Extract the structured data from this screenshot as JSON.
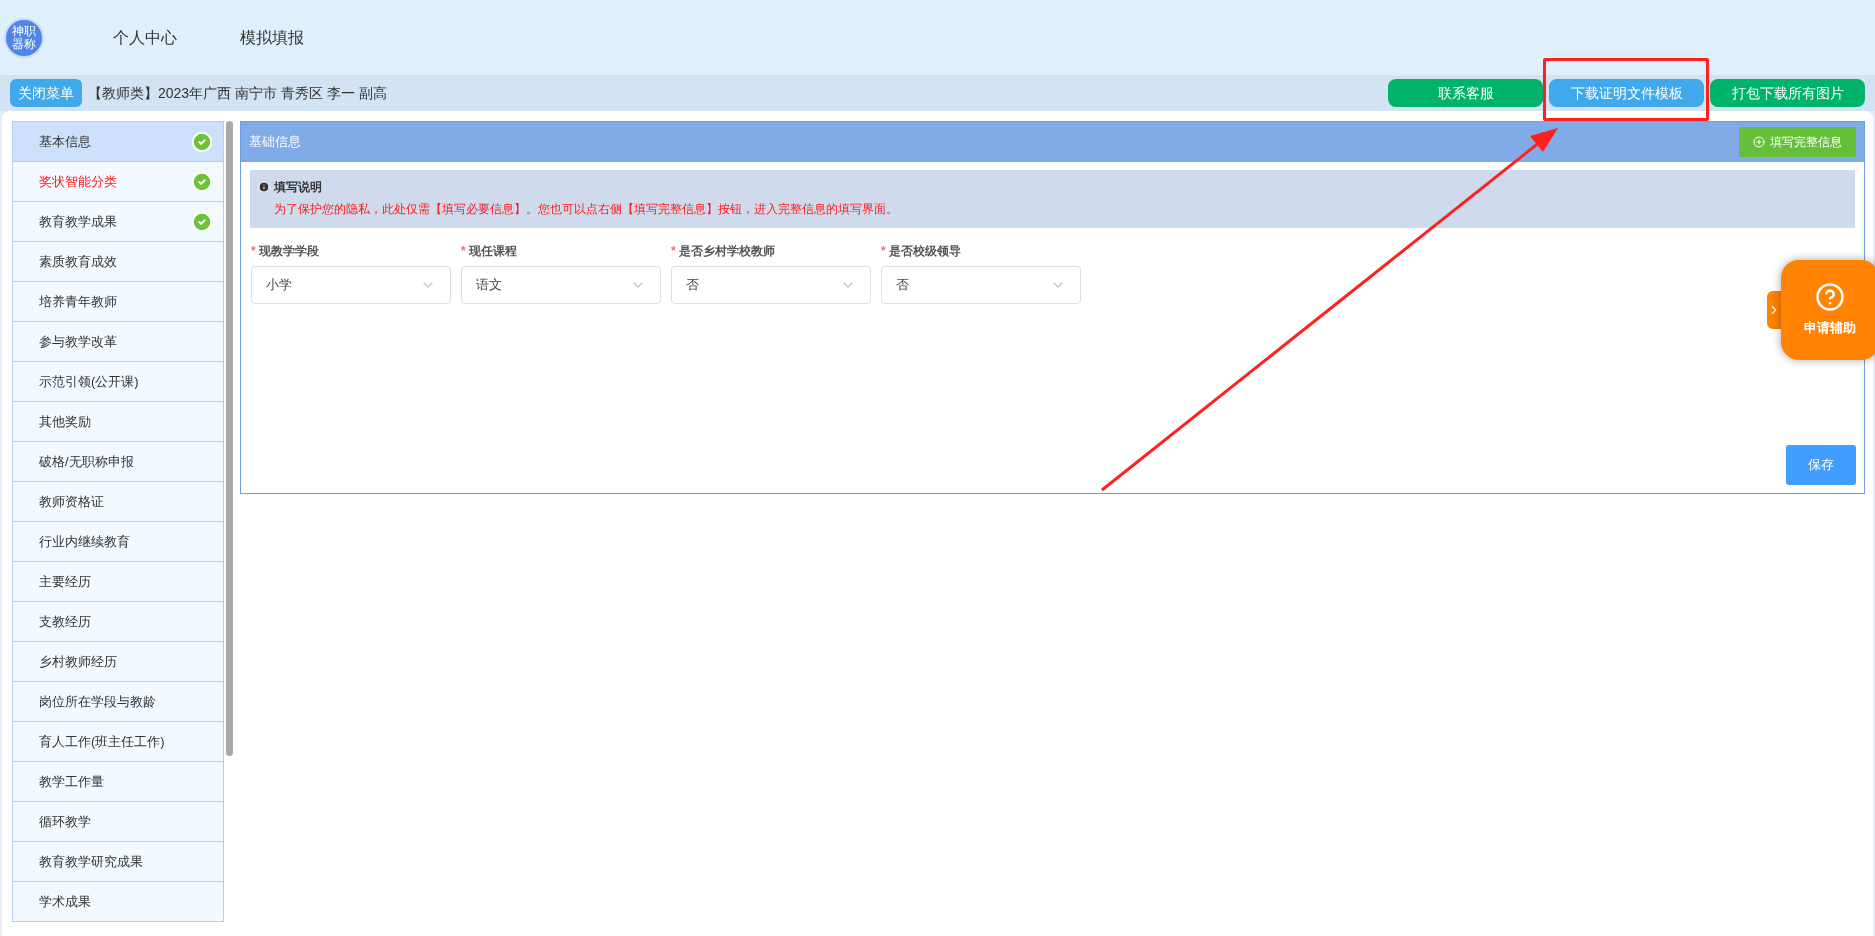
{
  "header": {
    "logo": "神职器称",
    "nav": [
      {
        "label": "个人中心"
      },
      {
        "label": "模拟填报"
      }
    ]
  },
  "toolbar": {
    "menu_button": "关闭菜单",
    "breadcrumb": "【教师类】2023年广西 南宁市 青秀区 李一 副高",
    "buttons": [
      {
        "label": "联系客服",
        "kind": "green"
      },
      {
        "label": "下载证明文件模板",
        "kind": "blue"
      },
      {
        "label": "打包下载所有图片",
        "kind": "green"
      }
    ]
  },
  "sidebar": {
    "items": [
      {
        "label": "基本信息",
        "selected": true,
        "done": true,
        "alert": false
      },
      {
        "label": "奖状智能分类",
        "selected": false,
        "done": true,
        "alert": true
      },
      {
        "label": "教育教学成果",
        "selected": false,
        "done": true,
        "alert": false
      },
      {
        "label": "素质教育成效",
        "selected": false,
        "done": false,
        "alert": false
      },
      {
        "label": "培养青年教师",
        "selected": false,
        "done": false,
        "alert": false
      },
      {
        "label": "参与教学改革",
        "selected": false,
        "done": false,
        "alert": false
      },
      {
        "label": "示范引领(公开课)",
        "selected": false,
        "done": false,
        "alert": false
      },
      {
        "label": "其他奖励",
        "selected": false,
        "done": false,
        "alert": false
      },
      {
        "label": "破格/无职称申报",
        "selected": false,
        "done": false,
        "alert": false
      },
      {
        "label": "教师资格证",
        "selected": false,
        "done": false,
        "alert": false
      },
      {
        "label": "行业内继续教育",
        "selected": false,
        "done": false,
        "alert": false
      },
      {
        "label": "主要经历",
        "selected": false,
        "done": false,
        "alert": false
      },
      {
        "label": "支教经历",
        "selected": false,
        "done": false,
        "alert": false
      },
      {
        "label": "乡村教师经历",
        "selected": false,
        "done": false,
        "alert": false
      },
      {
        "label": "岗位所在学段与教龄",
        "selected": false,
        "done": false,
        "alert": false
      },
      {
        "label": "育人工作(班主任工作)",
        "selected": false,
        "done": false,
        "alert": false
      },
      {
        "label": "教学工作量",
        "selected": false,
        "done": false,
        "alert": false
      },
      {
        "label": "循环教学",
        "selected": false,
        "done": false,
        "alert": false
      },
      {
        "label": "教育教学研究成果",
        "selected": false,
        "done": false,
        "alert": false
      },
      {
        "label": "学术成果",
        "selected": false,
        "done": false,
        "alert": false
      }
    ]
  },
  "panel": {
    "title": "基础信息",
    "fill_button": "填写完整信息",
    "notice": {
      "title": "填写说明",
      "text": "为了保护您的隐私，此处仅需【填写必要信息】。您也可以点右侧【填写完整信息】按钮，进入完整信息的填写界面。"
    },
    "fields": [
      {
        "label": "现教学学段",
        "value": "小学",
        "required_mark": "*"
      },
      {
        "label": "现任课程",
        "value": "语文",
        "required_mark": "*"
      },
      {
        "label": "是否乡村学校教师",
        "value": "否",
        "required_mark": "*"
      },
      {
        "label": "是否校级领导",
        "value": "否",
        "required_mark": "*"
      }
    ],
    "save_button": "保存"
  },
  "help_widget": {
    "label": "申请辅助"
  }
}
